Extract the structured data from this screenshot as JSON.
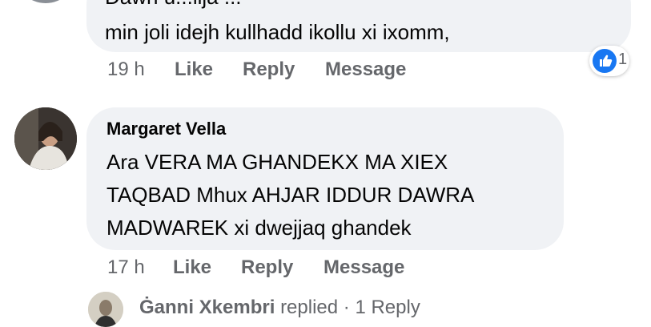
{
  "comments": [
    {
      "lines": [
        "Dawn u...ilja ...",
        "min joli idejh kullhadd ikollu xi ixomm,"
      ],
      "time": "19 h",
      "like": "Like",
      "reply": "Reply",
      "message": "Message",
      "reaction_icon": "thumbs-up-icon",
      "reaction_count": "1"
    },
    {
      "author": "Margaret Vella",
      "lines": [
        "Ara VERA MA GHANDEKX MA XIEX",
        "TAQBAD Mhux AHJAR IDDUR DAWRA",
        "MADWAREK xi dwejjaq ghandek"
      ],
      "time": "17 h",
      "like": "Like",
      "reply": "Reply",
      "message": "Message"
    }
  ],
  "reply_summary": {
    "name": "Ġanni Xkembri",
    "replied": "replied",
    "count": "· 1 Reply"
  },
  "colors": {
    "bubble": "#f0f2f5",
    "secondary_text": "#65676b",
    "like_blue": "#1877f2"
  }
}
